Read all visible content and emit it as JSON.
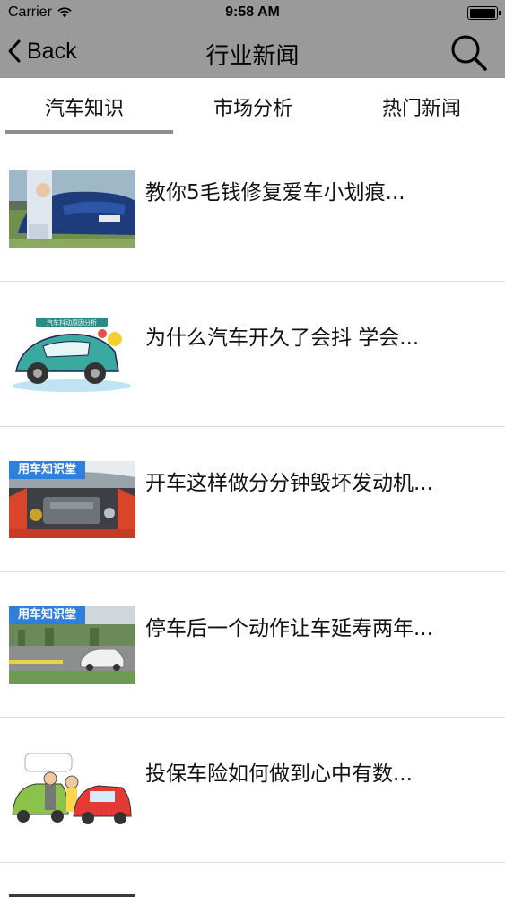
{
  "status_bar": {
    "carrier": "Carrier",
    "time": "9:58 AM"
  },
  "nav": {
    "back_label": "Back",
    "title": "行业新闻"
  },
  "tabs": [
    {
      "label": "汽车知识",
      "active": true
    },
    {
      "label": "市场分析",
      "active": false
    },
    {
      "label": "热门新闻",
      "active": false
    }
  ],
  "news": [
    {
      "title": "教你5毛钱修复爱车小划痕...",
      "thumb_icon": "car-scratch-photo"
    },
    {
      "title": "为什么汽车开久了会抖 学会...",
      "thumb_icon": "shaking-car-cartoon"
    },
    {
      "title": "开车这样做分分钟毁坏发动机...",
      "thumb_icon": "engine-bay-photo",
      "tag": "用车知识堂"
    },
    {
      "title": "停车后一个动作让车延寿两年...",
      "thumb_icon": "parking-lot-photo",
      "tag": "用车知识堂"
    },
    {
      "title": "投保车险如何做到心中有数...",
      "thumb_icon": "insurance-cartoon"
    }
  ],
  "colors": {
    "bar": "#9a9a9a",
    "tab_indicator": "#8e8e8e",
    "tag_blue": "#2f7fdd"
  }
}
